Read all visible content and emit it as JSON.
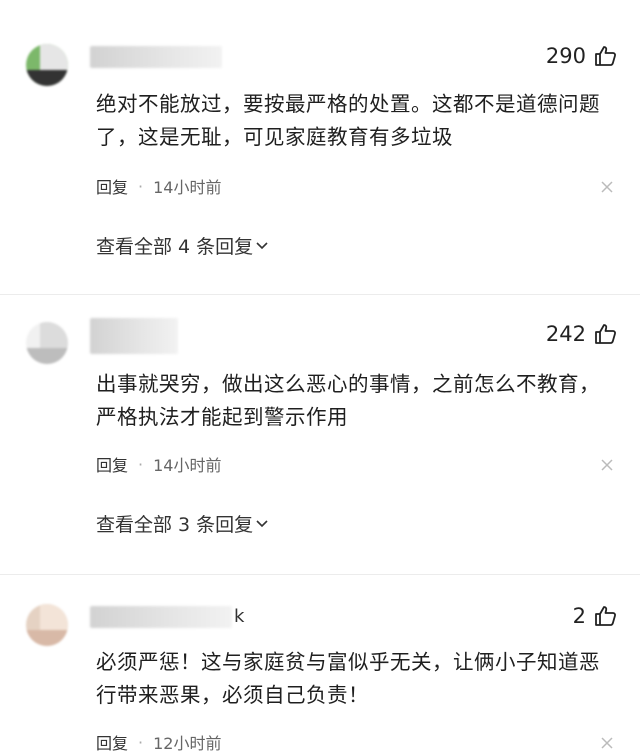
{
  "comments": [
    {
      "likes": "290",
      "text": "绝对不能放过，要按最严格的处置。这都不是道德问题了，这是无耻，可见家庭教育有多垃圾",
      "reply_label": "回复",
      "time": "14小时前",
      "view_replies": "查看全部 4 条回复"
    },
    {
      "likes": "242",
      "text": "出事就哭穷，做出这么恶心的事情，之前怎么不教育，严格执法才能起到警示作用",
      "reply_label": "回复",
      "time": "14小时前",
      "view_replies": "查看全部 3 条回复"
    },
    {
      "name_tail": "k",
      "likes": "2",
      "text": "必须严惩！这与家庭贫与富似乎无关，让俩小子知道恶行带来恶果，必须自己负责！",
      "reply_label": "回复",
      "time": "12小时前"
    }
  ],
  "icons": {
    "like": "thumbs-up-icon",
    "close": "close-icon",
    "expand": "chevron-down-icon"
  },
  "colors": {
    "text": "#1f1f1f",
    "meta": "#666666",
    "background": "#ffffff"
  }
}
